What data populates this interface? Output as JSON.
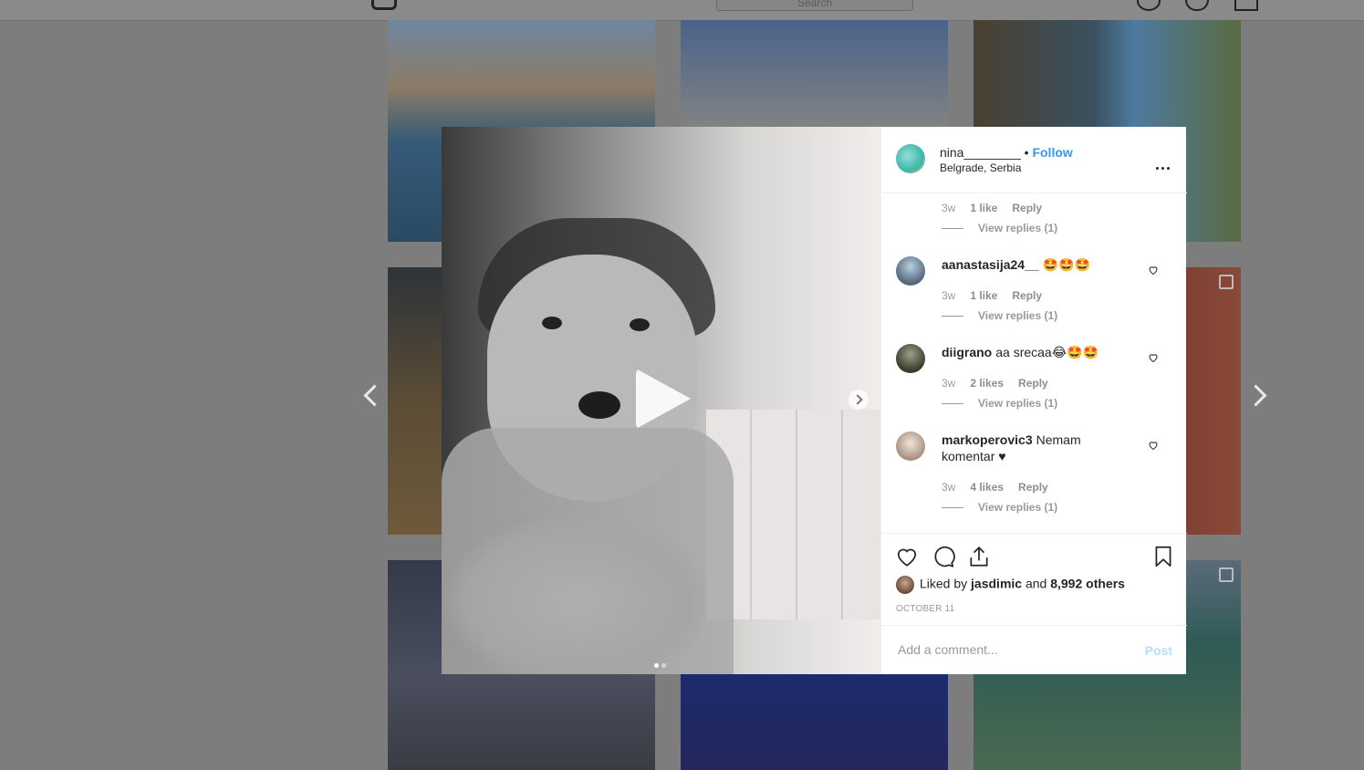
{
  "topbar": {
    "search_placeholder": "Search"
  },
  "post": {
    "username": "nina________",
    "separator": "•",
    "follow_label": "Follow",
    "location": "Belgrade, Serbia",
    "media_slides": 2,
    "media_active_slide": 1
  },
  "comments": [
    {
      "user": "",
      "text": "",
      "time": "3w",
      "likes": "1 like",
      "reply": "Reply",
      "view_replies": "View replies (1)"
    },
    {
      "user": "aanastasija24__",
      "text": "🤩🤩🤩",
      "time": "3w",
      "likes": "1 like",
      "reply": "Reply",
      "view_replies": "View replies (1)"
    },
    {
      "user": "diigrano",
      "text": "aa srecaa😂🤩🤩",
      "time": "3w",
      "likes": "2 likes",
      "reply": "Reply",
      "view_replies": "View replies (1)"
    },
    {
      "user": "markoperovic3",
      "text": "Nemam komentar ♥",
      "time": "3w",
      "likes": "4 likes",
      "reply": "Reply",
      "view_replies": "View replies (1)"
    }
  ],
  "likes": {
    "prefix": "Liked by",
    "user": "jasdimic",
    "conj": "and",
    "others": "8,992 others"
  },
  "date": "OCTOBER 11",
  "add_comment": {
    "placeholder": "Add a comment...",
    "post_label": "Post"
  },
  "colors": {
    "accent": "#3897f0",
    "post_disabled": "#b2dffc",
    "text": "#262626",
    "muted": "#999999"
  }
}
